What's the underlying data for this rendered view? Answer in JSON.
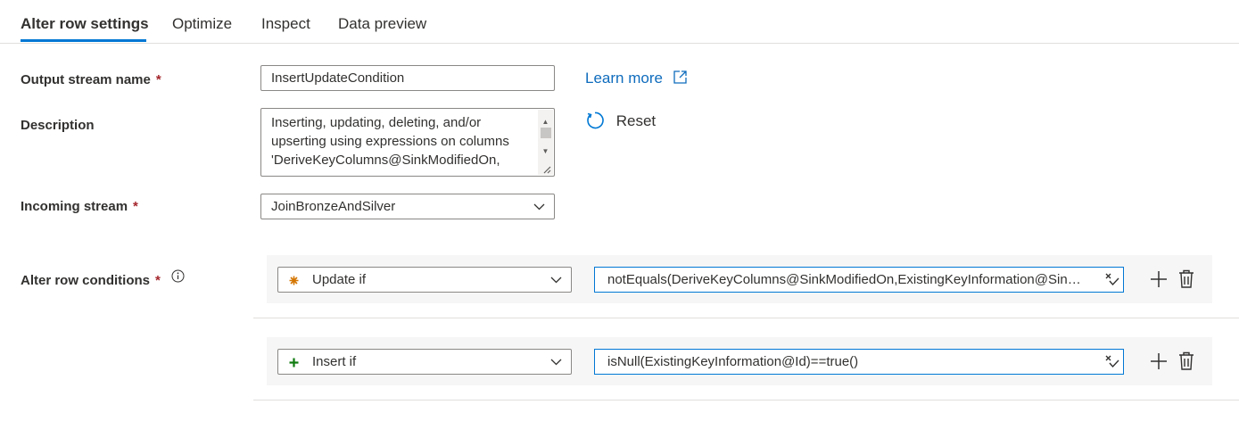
{
  "tabs": [
    {
      "label": "Alter row settings",
      "active": true
    },
    {
      "label": "Optimize",
      "active": false
    },
    {
      "label": "Inspect",
      "active": false
    },
    {
      "label": "Data preview",
      "active": false
    }
  ],
  "form": {
    "output_stream": {
      "label": "Output stream name",
      "required_mark": "*",
      "value": "InsertUpdateCondition"
    },
    "description": {
      "label": "Description",
      "value": "Inserting, updating, deleting, and/or upserting using expressions on columns 'DeriveKeyColumns@SinkModifiedOn,"
    },
    "incoming_stream": {
      "label": "Incoming stream",
      "required_mark": "*",
      "value": "JoinBronzeAndSilver"
    },
    "conditions_label": "Alter row conditions",
    "conditions_required_mark": "*"
  },
  "links": {
    "learn_more": "Learn more",
    "reset": "Reset"
  },
  "conditions": [
    {
      "type": "Update if",
      "type_icon": "asterisk-icon",
      "type_color": "#d47500",
      "expression": "notEquals(DeriveKeyColumns@SinkModifiedOn,ExistingKeyInformation@SinkModifiedOn)"
    },
    {
      "type": "Insert if",
      "type_icon": "plus-icon",
      "type_color": "#107c10",
      "expression": "isNull(ExistingKeyInformation@Id)==true()"
    }
  ],
  "colors": {
    "accent": "#0078d4",
    "link": "#0f6cbd",
    "required": "#a4262c"
  }
}
